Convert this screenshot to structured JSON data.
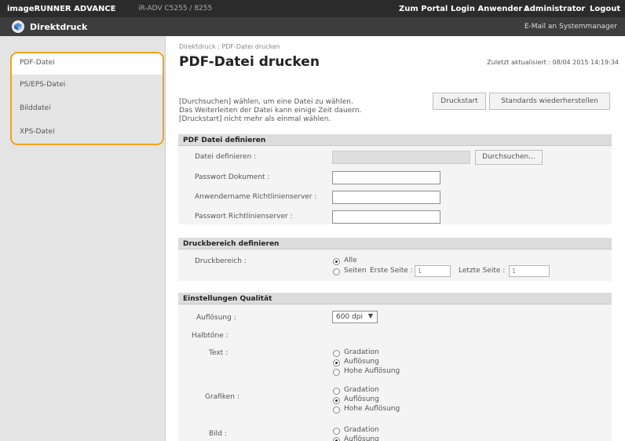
{
  "header": {
    "brand": "imageRUNNER ADVANCE",
    "device": "iR-ADV C5255 / 8255",
    "portal": "Zum Portal",
    "login": "Login Anwender :",
    "admin": "Administrator",
    "logout": "Logout"
  },
  "subheader": {
    "title": "Direktdruck",
    "mail": "E-Mail an Systemmanager"
  },
  "sidebar": {
    "items": [
      {
        "label": "PDF-Datei"
      },
      {
        "label": "PS/EPS-Datei"
      },
      {
        "label": "Bilddatei"
      },
      {
        "label": "XPS-Datei"
      }
    ]
  },
  "main": {
    "breadcrumb": "Direktdruck : PDF-Datei drucken",
    "title": "PDF-Datei drucken",
    "updated": "Zuletzt aktualisiert : 08/04 2015 14:19:34",
    "instruction1": "[Durchsuchen] wählen, um eine Datei zu wählen.",
    "instruction2": "Das Weiterleiten der Datei kann einige Zeit dauern.",
    "instruction3": "[Druckstart] nicht mehr als einmal wählen.",
    "start_button": "Druckstart",
    "reset_button": "Standards wiederherstellen"
  },
  "file_section": {
    "heading": "PDF Datei definieren",
    "file_label": "Datei definieren :",
    "browse_button": "Durchsuchen...",
    "doc_password_label": "Passwort Dokument :",
    "username_label": "Anwendername Richtlinienserver :",
    "policy_password_label": "Passwort Richtlinienserver :"
  },
  "range_section": {
    "heading": "Druckbereich definieren",
    "label": "Druckbereich :",
    "all": "Alle",
    "pages": "Seiten",
    "first_label": "Erste Seite :",
    "first_value": "1",
    "last_label": "Letzte Seite :",
    "last_value": "1"
  },
  "quality_section": {
    "heading": "Einstellungen Qualität",
    "resolution_label": "Auflösung :",
    "resolution_value": "600 dpi",
    "halftones_label": "Halbtöne :",
    "text_label": "Text :",
    "graphics_label": "Grafiken :",
    "image_label": "Bild :",
    "opt_gradation": "Gradation",
    "opt_resolution": "Auflösung",
    "opt_high": "Hohe Auflösung"
  },
  "colors": {
    "topbar": "#2b2b2b",
    "subbar": "#3d3d3d",
    "highlight": "#f0a21b",
    "sidebar": "#e4e4e4"
  }
}
